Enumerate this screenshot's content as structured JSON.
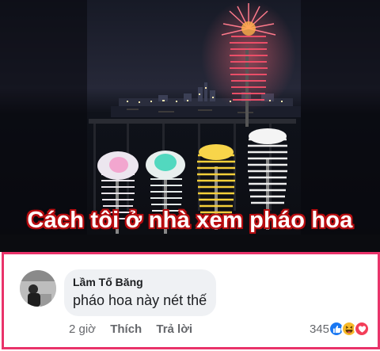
{
  "post": {
    "image_caption": "Cách tôi ở nhà xem pháo hoa"
  },
  "comment": {
    "author": "Lầm Tố Băng",
    "text": "pháo hoa này nét thế",
    "timestamp": "2 giờ",
    "like_label": "Thích",
    "reply_label": "Trả lời",
    "reaction_count": "345",
    "reactions": [
      "like-icon",
      "haha-icon",
      "love-icon"
    ]
  },
  "colors": {
    "panel_border": "#e9336a",
    "caption_outline": "#b80d10",
    "like_blue": "#1877f2",
    "love_red": "#f33e58",
    "haha_yellow": "#f7b928"
  }
}
